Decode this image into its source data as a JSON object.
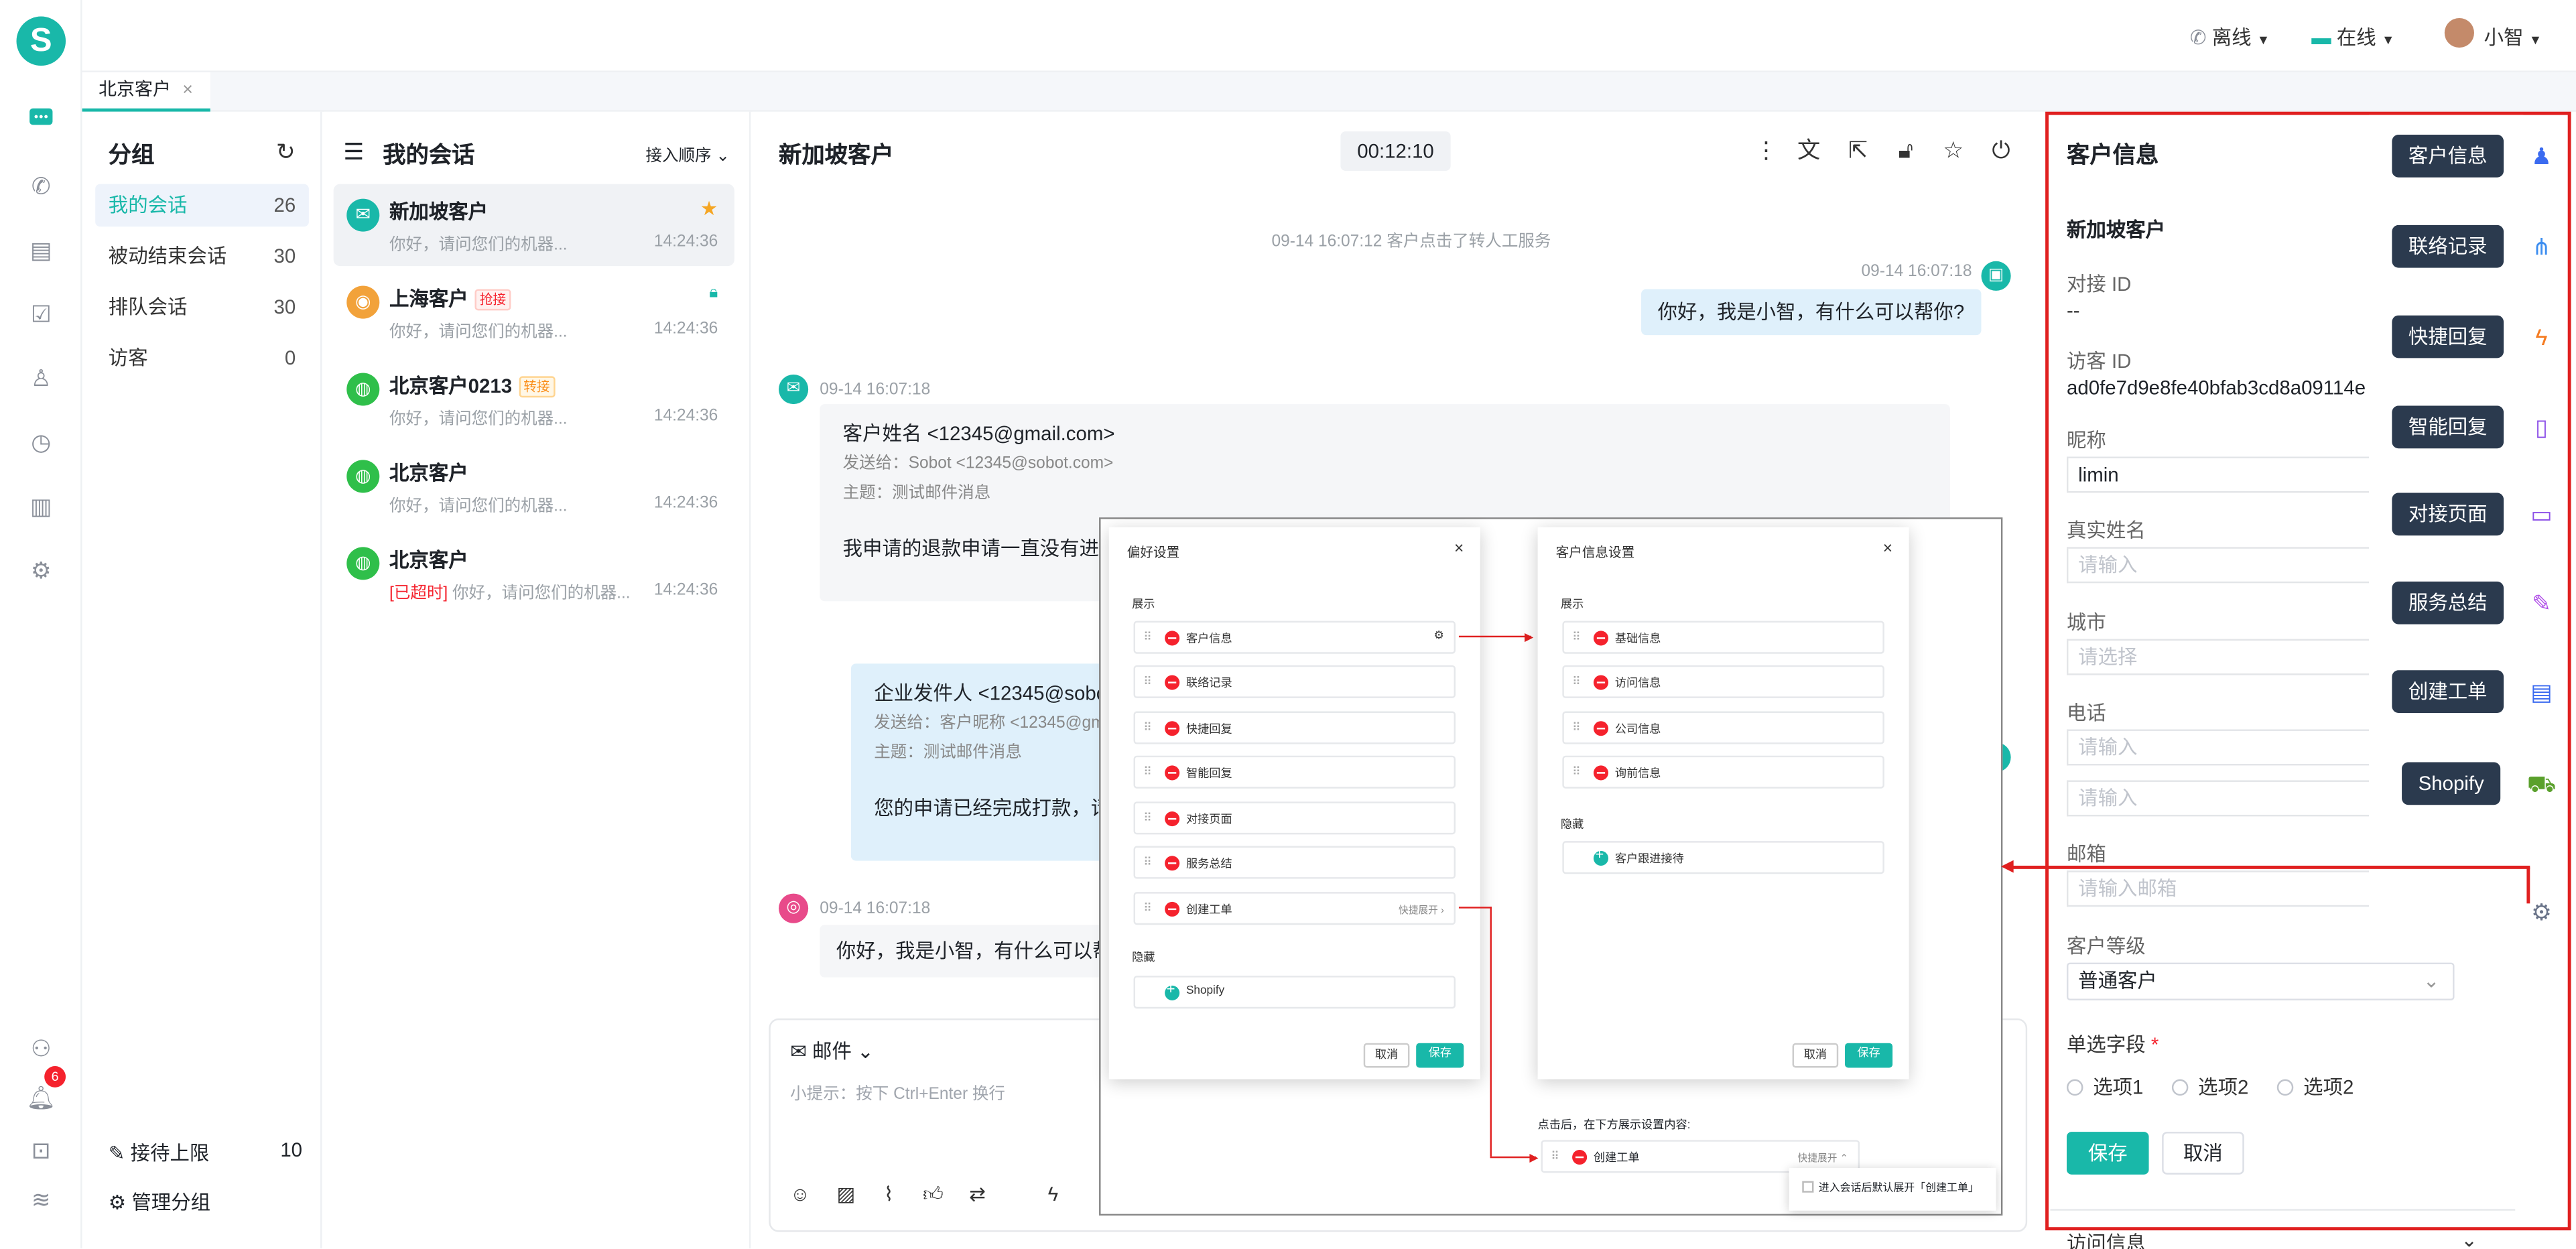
{
  "header": {
    "status_phone": "离线",
    "status_online": "在线",
    "user_name": "小智"
  },
  "nav": {
    "notification_count": "6"
  },
  "tabs": [
    {
      "label": "北京客户",
      "close": "×"
    }
  ],
  "groups": {
    "title": "分组",
    "items": [
      {
        "label": "我的会话",
        "count": "26"
      },
      {
        "label": "被动结束会话",
        "count": "30"
      },
      {
        "label": "排队会话",
        "count": "30"
      },
      {
        "label": "访客",
        "count": "0"
      }
    ],
    "limit_label": "接待上限",
    "limit_value": "10",
    "manage_label": "管理分组"
  },
  "conversations": {
    "title": "我的会话",
    "sort_label": "接入顺序",
    "items": [
      {
        "name": "新加坡客户",
        "tag": "",
        "preview": "你好，请问您们的机器...",
        "time": "14:24:36"
      },
      {
        "name": "上海客户",
        "tag": "抢接",
        "preview": "你好，请问您们的机器...",
        "time": "14:24:36"
      },
      {
        "name": "北京客户0213",
        "tag": "转接",
        "preview": "你好，请问您们的机器...",
        "time": "14:24:36"
      },
      {
        "name": "北京客户",
        "tag": "",
        "preview": "你好，请问您们的机器...",
        "time": "14:24:36"
      },
      {
        "name": "北京客户",
        "tag": "",
        "overdue": "[已超时]",
        "preview": "你好，请问您们的机器...",
        "time": "14:24:36"
      }
    ]
  },
  "chat": {
    "title": "新加坡客户",
    "timer": "00:12:10",
    "system_msg": "09-14 16:07:12 客户点击了转人工服务",
    "agent_time": "09-14 16:07:18",
    "agent_msg": "你好，我是小智，有什么可以帮你?",
    "mail1_time": "09-14 16:07:18",
    "mail1_title": "客户姓名 <12345@gmail.com>",
    "mail1_to": "发送给：Sobot <12345@sobot.com>",
    "mail1_subject": "主题：测试邮件消息",
    "mail1_body": "我申请的退款申请一直没有进展",
    "mail2_title": "企业发件人 <12345@sobot",
    "mail2_to": "发送给：客户昵称 <12345@gm",
    "mail2_subject": "主题：测试邮件消息",
    "mail2_body": "您的申请已经完成打款，请",
    "ins_time": "09-14 16:07:18",
    "ins_msg": "你好，我是小智，有什么可以帮",
    "composer_channel": "邮件",
    "composer_hint": "小提示：按下 Ctrl+Enter 换行"
  },
  "overlay": {
    "pref": {
      "title": "偏好设置",
      "show_label": "展示",
      "items": [
        "客户信息",
        "联络记录",
        "快捷回复",
        "智能回复",
        "对接页面",
        "服务总结",
        "创建工单"
      ],
      "expand_label": "快捷展开",
      "hidden_label": "隐藏",
      "hidden_items": [
        "Shopify"
      ],
      "cancel": "取消",
      "save": "保存"
    },
    "info": {
      "title": "客户信息设置",
      "show_label": "展示",
      "items": [
        "基础信息",
        "访问信息",
        "公司信息",
        "询前信息"
      ],
      "hidden_label": "隐藏",
      "hidden_items": [
        "客户跟进接待"
      ],
      "cancel": "取消",
      "save": "保存"
    },
    "note": "点击后，在下方展示设置内容:",
    "ticket_label": "创建工单",
    "ticket_expand": "快捷展开",
    "ticket_checkbox": "进入会话后默认展开「创建工单」"
  },
  "customer": {
    "title": "客户信息",
    "name": "新加坡客户",
    "fields": {
      "dock_id_label": "对接 ID",
      "dock_id_value": "--",
      "visitor_id_label": "访客 ID",
      "visitor_id_value": "ad0fe7d9e8fe40bfab3cd8a09114e",
      "nickname_label": "昵称",
      "nickname_value": "limin",
      "realname_label": "真实姓名",
      "realname_placeholder": "请输入",
      "city_label": "城市",
      "city_placeholder": "请选择",
      "phone_label": "电话",
      "phone_placeholder": "请输入",
      "phone2_placeholder": "请输入",
      "email_label": "邮箱",
      "email_placeholder": "请输入邮箱",
      "level_label": "客户等级",
      "level_value": "普通客户",
      "single_label": "单选字段",
      "options": [
        "选项1",
        "选项2",
        "选项2"
      ]
    },
    "save": "保存",
    "cancel": "取消",
    "visit_info": "访问信息"
  },
  "floating_menu": [
    "客户信息",
    "联络记录",
    "快捷回复",
    "智能回复",
    "对接页面",
    "服务总结",
    "创建工单",
    "Shopify"
  ],
  "colors": {
    "brand": "#19b8a9",
    "highlight_border": "#e02020",
    "pill_bg": "#2b3a4e"
  }
}
